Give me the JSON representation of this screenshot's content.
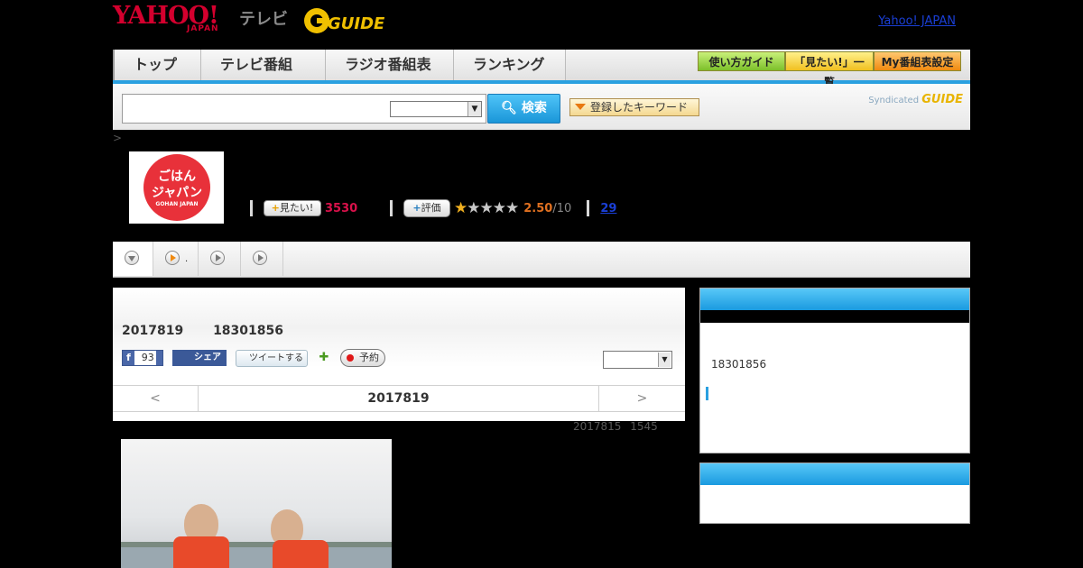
{
  "header": {
    "logo_yahoo": "YAHOO!",
    "logo_japan": "JAPAN",
    "logo_tv": "テレビ",
    "logo_gguide": "GUIDE",
    "yahoo_japan_link": "Yahoo! JAPAN"
  },
  "nav": {
    "tabs": [
      {
        "label": "トップ"
      },
      {
        "label": "テレビ番組表"
      },
      {
        "label": "ラジオ番組表"
      },
      {
        "label": "ランキング"
      }
    ],
    "buttons": [
      {
        "label": "使い方ガイド",
        "color": "#7cc02a"
      },
      {
        "label": "「見たい!」一覧",
        "color": "#f0c020"
      },
      {
        "label": "My番組表設定",
        "color": "#f08a10"
      }
    ]
  },
  "search": {
    "input_value": "",
    "select_value": "",
    "button_label": "検索",
    "keyword_button_label": "登録したキーワード",
    "syndicated_label": "Syndicated",
    "syndicated_brand": "GUIDE"
  },
  "breadcrumb": ">",
  "program": {
    "image_title_line1": "ごはん",
    "image_title_line2": "ジャパン",
    "image_subtitle": "GOHAN JAPAN",
    "mitai_label": "見たい!",
    "mitai_count": "3530",
    "hyoka_label": "評価",
    "rating_value": 2.5,
    "rating": "2.50",
    "rating_max": "/10",
    "review_count": "29"
  },
  "subtabs": [
    {
      "icon": "dropdown-icon"
    },
    {
      "icon": "play-icon",
      "text": "."
    },
    {
      "icon": "play-icon"
    },
    {
      "icon": "play-icon"
    }
  ],
  "episode": {
    "air_date": "2017819 18301856",
    "fb_like_count": "93",
    "fb_share_label": "シェア",
    "tweet_label": "ツイートする",
    "reserve_label": "予約",
    "select_value": "",
    "prev_label": "<",
    "center_date": "2017819",
    "next_label": ">",
    "updated": "2017815 1545"
  },
  "sidebar": {
    "time": "18301856"
  },
  "colors": {
    "accent": "#2aa0e0",
    "brand_red": "#d4002e",
    "mitai_red": "#d8114a"
  }
}
